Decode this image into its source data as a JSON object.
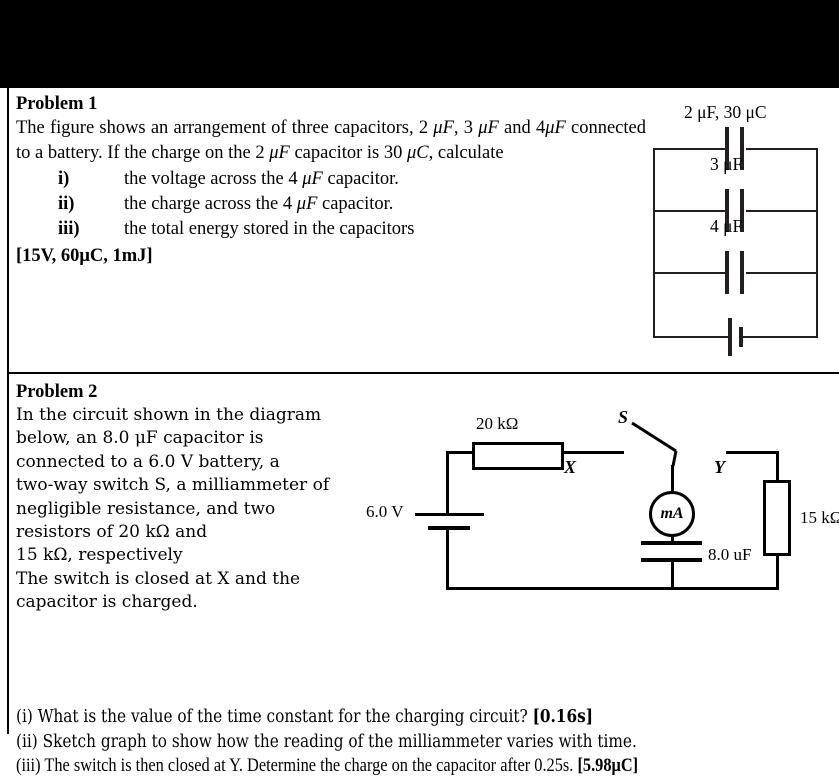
{
  "problem1": {
    "heading": "Problem 1",
    "body_part1": "The figure shows an arrangement of three capacitors, 2 ",
    "body_unit_a": "μF",
    "body_part2": ", 3 ",
    "body_unit_b": "μF",
    "body_part3": " and 4",
    "body_unit_c": "μF",
    "body_part4": " connected to a battery. If the charge on the 2 ",
    "body_unit_d": "μF",
    "body_part5": " capacitor is 30 ",
    "body_unit_e": "μC",
    "body_part6": ", calculate",
    "items": [
      {
        "num": "i)",
        "text_a": "the voltage across the 4 ",
        "unit": "μF",
        "text_b": " capacitor."
      },
      {
        "num": "ii)",
        "text_a": "the charge across the 4 ",
        "unit": "μF",
        "text_b": " capacitor."
      },
      {
        "num": "iii)",
        "text_a": "the total energy stored in the capacitors",
        "unit": "",
        "text_b": ""
      }
    ],
    "answers": "[15V, 60μC, 1mJ]",
    "circuit": {
      "label_top": "2 μF, 30 μC",
      "label_mid": "3 μF",
      "label_low": "4 μF",
      "battery_name": "battery-symbol"
    }
  },
  "problem2": {
    "heading": "Problem 2",
    "paragraph_lines": [
      "In the circuit shown in the diagram",
      "below, an 8.0 μF capacitor is",
      "connected to a 6.0 V battery, a",
      "two-way switch S, a milliammeter of",
      "negligible resistance, and two",
      "resistors of 20 kΩ and",
      "15 kΩ, respectively",
      "The switch is closed at X and the",
      "capacitor is charged."
    ],
    "tail": {
      "line1_text": "(i) What is the value of the time constant for the charging circuit? ",
      "line1_answer": "[0.16s]",
      "line2_text": "(ii) Sketch graph to show how the reading of the milliammeter varies with time.",
      "line3_text": "(iii) The switch is then closed at Y. Determine the charge on the capacitor after 0.25s. ",
      "line3_answer": "[5.98μC]"
    },
    "circuit": {
      "battery_label": "6.0 V",
      "resistor_top_label": "20 kΩ",
      "resistor_right_label": "15 kΩ",
      "switch_label": "S",
      "contact_x_label": "X",
      "contact_y_label": "Y",
      "meter_label": "mA",
      "capacitor_label": "8.0 uF"
    }
  },
  "colors": {
    "ink": "#000000",
    "paper": "#ffffff",
    "letterbox": "#000000",
    "circuit_ink": "#231f20"
  }
}
